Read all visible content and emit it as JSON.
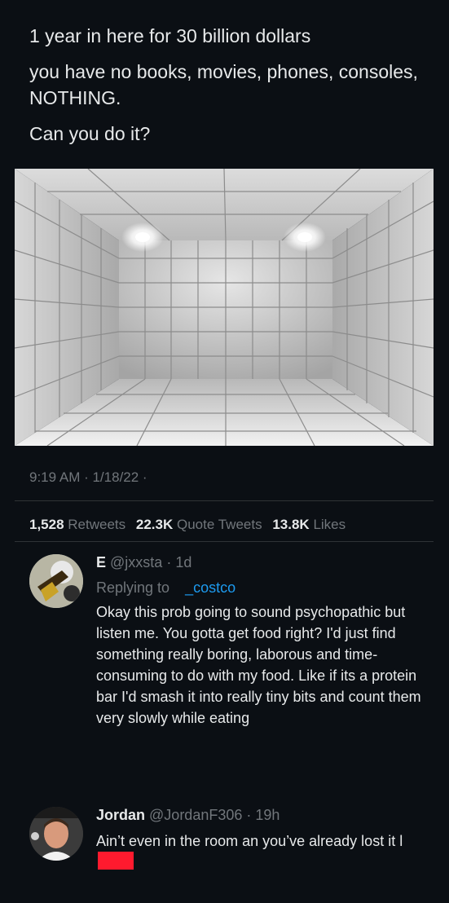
{
  "tweet": {
    "lines": [
      "1 year in here for 30 billion dollars",
      "you have no books, movies, phones, consoles, NOTHING.",
      "Can you do it?"
    ],
    "meta": "9:19 AM · 1/18/22 ·"
  },
  "stats": {
    "retweets_count": "1,528",
    "retweets_label": "Retweets",
    "quotes_count": "22.3K",
    "quotes_label": "Quote Tweets",
    "likes_count": "13.8K",
    "likes_label": "Likes"
  },
  "replies": [
    {
      "name": "E",
      "handle": "@jxxsta",
      "time": "· 1d",
      "replying_label": "Replying to",
      "replying_handle": "_costco",
      "text": "Okay this prob going to sound psychopathic but listen me. You gotta get food right? I'd just find something really boring, laborous and time-consuming to do with my food. Like if its a protein bar I'd smash it into really tiny bits and count them very slowly while eating"
    },
    {
      "name": "Jordan",
      "handle": "@JordanF306",
      "time": "· 19h",
      "text": "Ain’t even in the room an you’ve already lost it l"
    }
  ],
  "colors": {
    "background": "#0b0f14",
    "text": "#e7e9ea",
    "muted": "#71767b",
    "link": "#1d9bf0",
    "redaction": "#ff1a2e"
  }
}
